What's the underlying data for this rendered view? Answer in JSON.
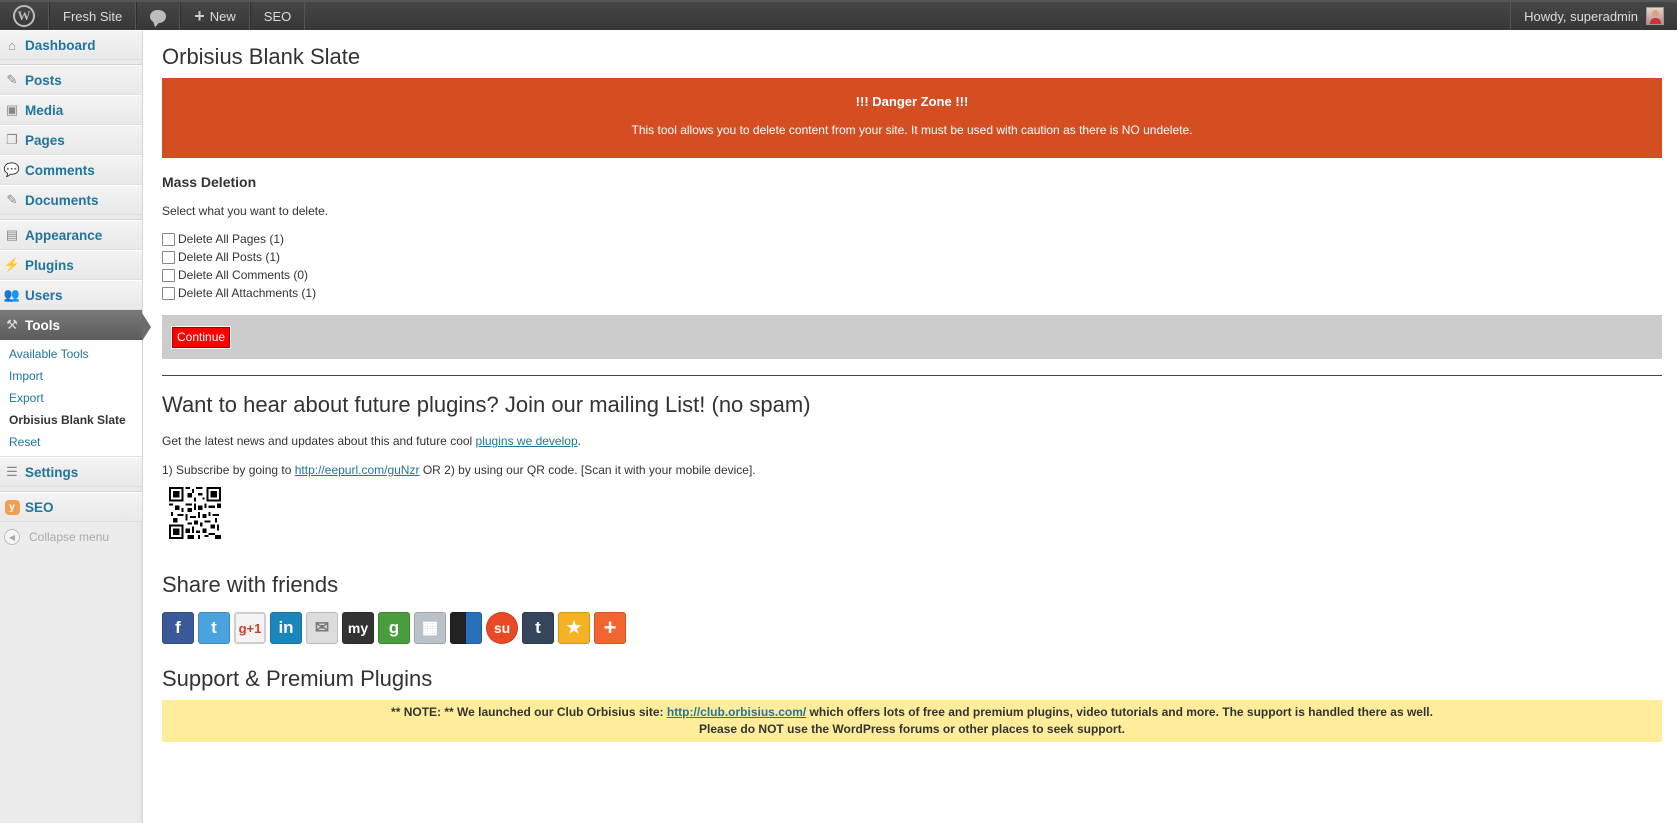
{
  "adminbar": {
    "site_name": "Fresh Site",
    "new_label": "New",
    "seo_label": "SEO",
    "howdy": "Howdy, superadmin"
  },
  "sidebar": {
    "items": [
      {
        "label": "Dashboard",
        "icon": "dashboard-icon"
      },
      {
        "label": "Posts",
        "icon": "pin-icon"
      },
      {
        "label": "Media",
        "icon": "media-icon"
      },
      {
        "label": "Pages",
        "icon": "pages-icon"
      },
      {
        "label": "Comments",
        "icon": "comments-icon"
      },
      {
        "label": "Documents",
        "icon": "pin-icon"
      },
      {
        "label": "Appearance",
        "icon": "appearance-icon"
      },
      {
        "label": "Plugins",
        "icon": "plugins-icon"
      },
      {
        "label": "Users",
        "icon": "users-icon"
      },
      {
        "label": "Tools",
        "icon": "tools-icon"
      },
      {
        "label": "Settings",
        "icon": "settings-icon"
      },
      {
        "label": "SEO",
        "icon": "seo-icon"
      }
    ],
    "tools_submenu": [
      "Available Tools",
      "Import",
      "Export",
      "Orbisius Blank Slate",
      "Reset"
    ],
    "collapse_label": "Collapse menu"
  },
  "main": {
    "title": "Orbisius Blank Slate",
    "danger_title": "!!! Danger Zone !!!",
    "danger_text": "This tool allows you to delete content from your site. It must be used with caution as there is NO undelete.",
    "mass_heading": "Mass Deletion",
    "select_text": "Select what you want to delete.",
    "checkboxes": [
      "Delete All Pages (1)",
      "Delete All Posts (1)",
      "Delete All Comments (0)",
      "Delete All Attachments (1)"
    ],
    "continue_label": "Continue",
    "mailing_heading": "Want to hear about future plugins? Join our mailing List! (no spam)",
    "news_pre": "Get the latest news and updates about this and future cool ",
    "news_link": "plugins we develop",
    "news_post": ".",
    "subscribe_pre": "1) Subscribe by going to ",
    "subscribe_link": "http://eepurl.com/guNzr",
    "subscribe_post": " OR 2) by using our QR code. [Scan it with your mobile device].",
    "share_heading": "Share with friends",
    "share_buttons": [
      {
        "name": "facebook-icon",
        "glyph": "f",
        "color": "#3b5998"
      },
      {
        "name": "twitter-icon",
        "glyph": "t",
        "color": "#4aa3df"
      },
      {
        "name": "google-plus-one-icon",
        "glyph": "g+1",
        "color": "#f4f4f4"
      },
      {
        "name": "linkedin-icon",
        "glyph": "in",
        "color": "#1b86bc"
      },
      {
        "name": "email-icon",
        "glyph": "✉",
        "color": "#d9d9d9"
      },
      {
        "name": "myspace-icon",
        "glyph": "my",
        "color": "#333333"
      },
      {
        "name": "google-icon",
        "glyph": "g",
        "color": "#4a9d3c"
      },
      {
        "name": "digg-icon",
        "glyph": "▦",
        "color": "#b9c2c8"
      },
      {
        "name": "delicious-icon",
        "glyph": "◧",
        "color": "#2a6fbd"
      },
      {
        "name": "stumbleupon-icon",
        "glyph": "su",
        "color": "#eb4924"
      },
      {
        "name": "tumblr-icon",
        "glyph": "t",
        "color": "#35465c"
      },
      {
        "name": "favorites-star-icon",
        "glyph": "★",
        "color": "#f5b323"
      },
      {
        "name": "more-plus-icon",
        "glyph": "+",
        "color": "#f26530"
      }
    ],
    "support_heading": "Support & Premium Plugins",
    "note_pre": "** NOTE: ** We launched our Club Orbisius site: ",
    "note_link": "http://club.orbisius.com/",
    "note_post": " which offers lots of free and premium plugins, video tutorials and more. The support is handled there as well.",
    "note_line2": "Please do NOT use the WordPress forums or other places to seek support."
  },
  "colors": {
    "danger": "#d54e21",
    "continue_button": "#ff0000",
    "note_background": "#ffed9c",
    "link": "#21759b"
  }
}
